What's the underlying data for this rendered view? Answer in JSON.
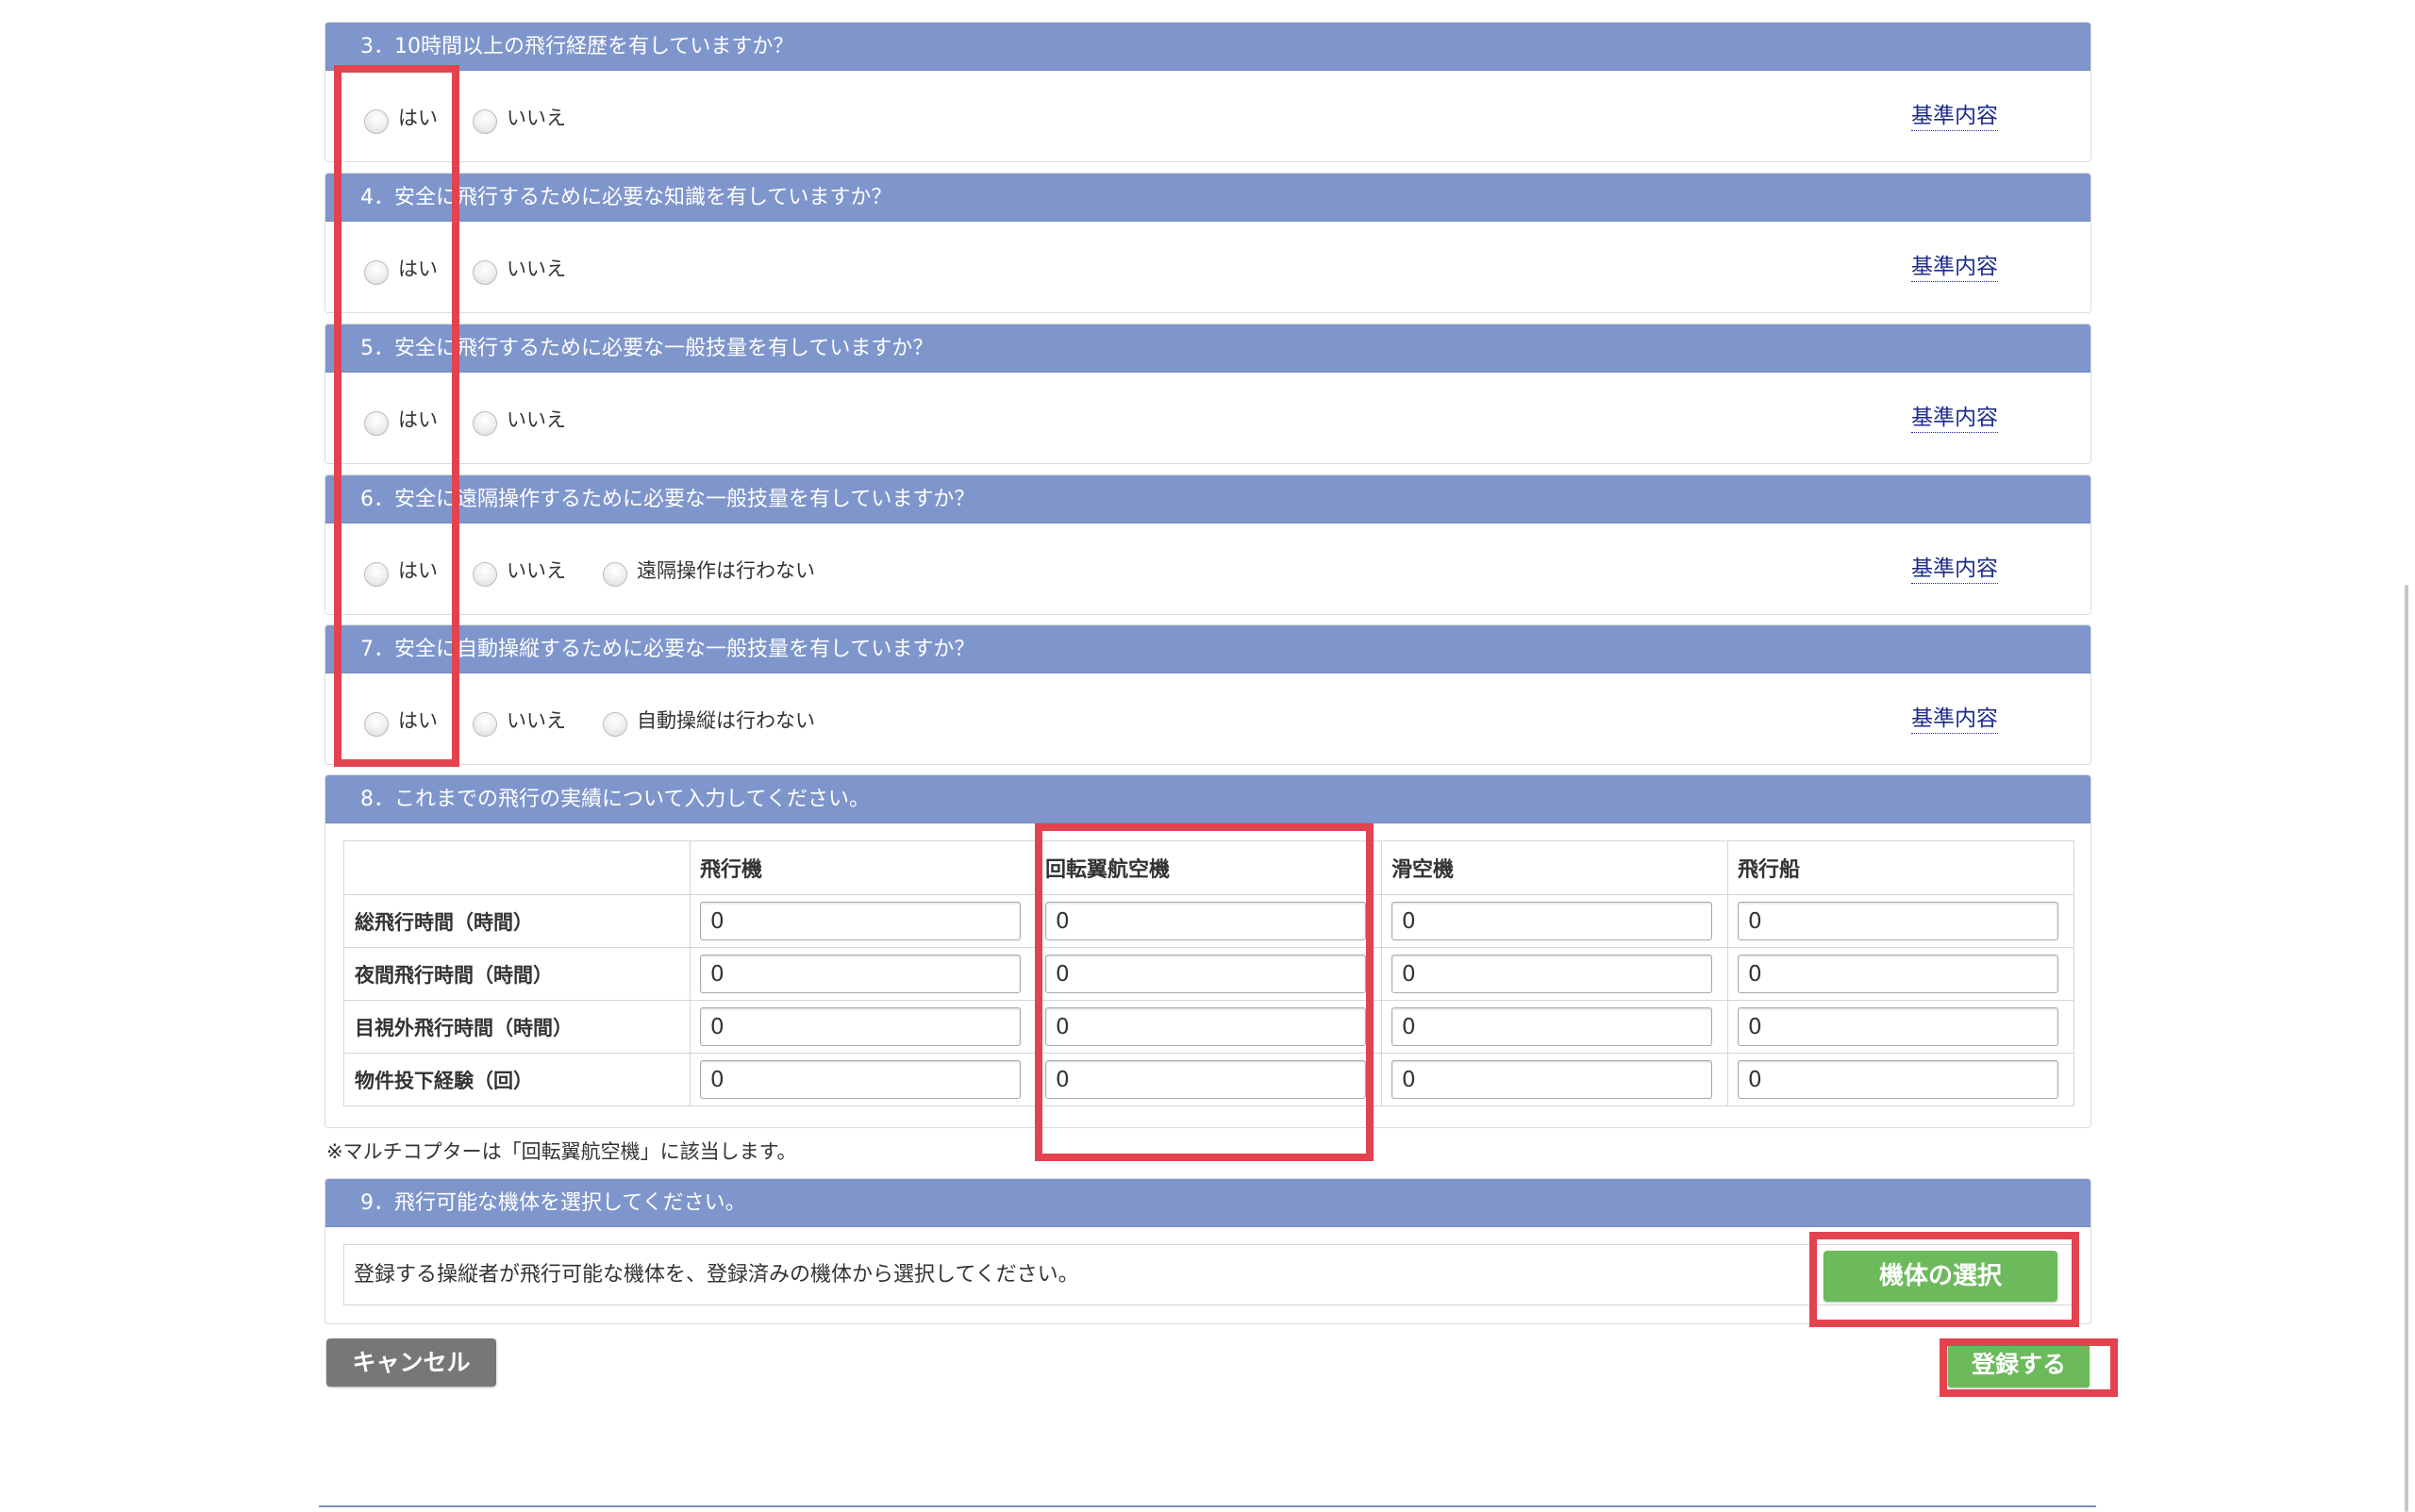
{
  "questions": [
    {
      "title": "3．10時間以上の飛行経歴を有していますか？",
      "options": [
        "はい",
        "いいえ"
      ],
      "criteria_link": "基準内容"
    },
    {
      "title": "4．安全に飛行するために必要な知識を有していますか？",
      "options": [
        "はい",
        "いいえ"
      ],
      "criteria_link": "基準内容"
    },
    {
      "title": "5．安全に飛行するために必要な一般技量を有していますか？",
      "options": [
        "はい",
        "いいえ"
      ],
      "criteria_link": "基準内容"
    },
    {
      "title": "6．安全に遠隔操作するために必要な一般技量を有していますか？",
      "options": [
        "はい",
        "いいえ",
        "遠隔操作は行わない"
      ],
      "criteria_link": "基準内容"
    },
    {
      "title": "7．安全に自動操縦するために必要な一般技量を有していますか？",
      "options": [
        "はい",
        "いいえ",
        "自動操縦は行わない"
      ],
      "criteria_link": "基準内容"
    }
  ],
  "flight_record": {
    "title": "8．これまでの飛行の実績について入力してください。",
    "columns": [
      "飛行機",
      "回転翼航空機",
      "滑空機",
      "飛行船"
    ],
    "rows": [
      {
        "label": "総飛行時間（時間）",
        "values": [
          "0",
          "0",
          "0",
          "0"
        ]
      },
      {
        "label": "夜間飛行時間（時間）",
        "values": [
          "0",
          "0",
          "0",
          "0"
        ]
      },
      {
        "label": "目視外飛行時間（時間）",
        "values": [
          "0",
          "0",
          "0",
          "0"
        ]
      },
      {
        "label": "物件投下経験（回）",
        "values": [
          "0",
          "0",
          "0",
          "0"
        ]
      }
    ],
    "note": "※マルチコプターは「回転翼航空機」に該当します。"
  },
  "aircraft_selection": {
    "title": "9．飛行可能な機体を選択してください。",
    "instruction": "登録する操縦者が飛行可能な機体を、登録済みの機体から選択してください。",
    "select_button": "機体の選択"
  },
  "actions": {
    "cancel": "キャンセル",
    "register": "登録する"
  },
  "colors": {
    "section_header_bg": "#7f96cc",
    "primary_button": "#6cba5b",
    "cancel_button": "#777777",
    "link": "#1d2c8c",
    "annotation_highlight": "#e2434f"
  }
}
